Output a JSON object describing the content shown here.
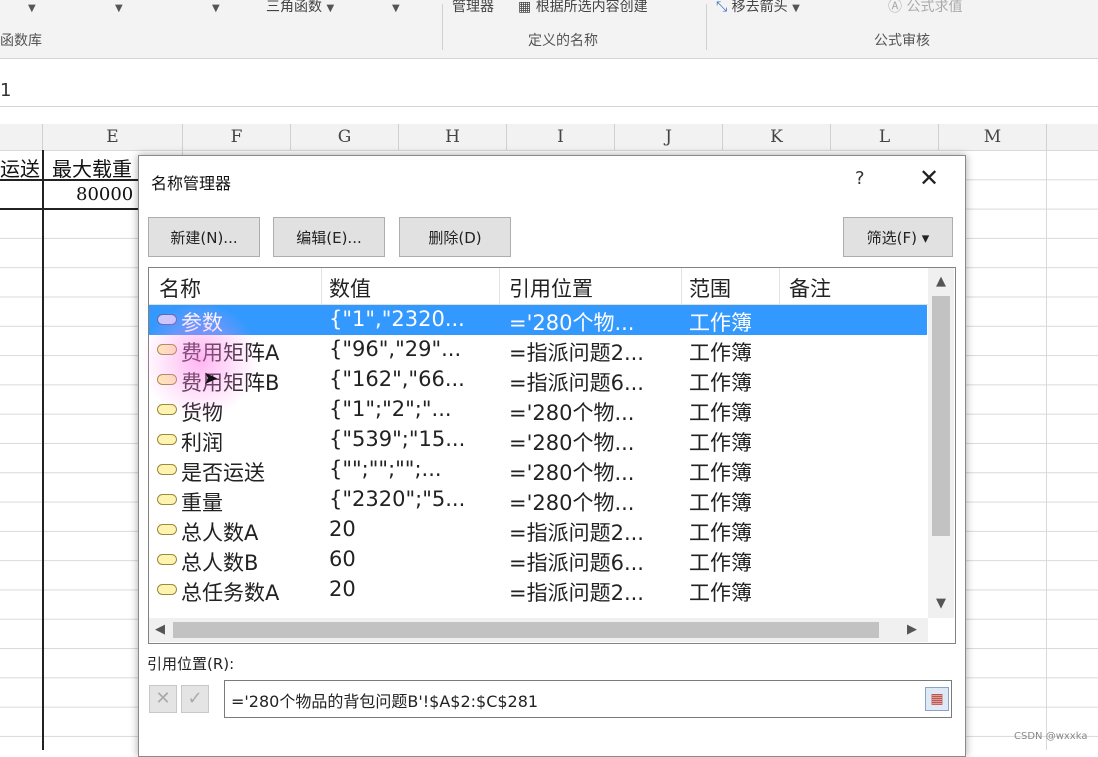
{
  "ribbon": {
    "fn_library_label": "函数库",
    "trig_label": "三角函数",
    "name_manager_label": "管理器",
    "create_from_selection_label": "根据所选内容创建",
    "remove_arrows_label": "移去箭头",
    "show_formulas_label": "公式求值",
    "defined_names_group": "定义的名称",
    "formula_audit_group": "公式审核"
  },
  "formula_bar": {
    "cell_ref": "1"
  },
  "sheet": {
    "columns": [
      "E",
      "F",
      "G",
      "H",
      "I",
      "J",
      "K",
      "L",
      "M"
    ],
    "cells": {
      "d1": "运送",
      "e1": "最大载重",
      "e2": "80000"
    }
  },
  "dialog": {
    "title": "名称管理器",
    "help": "?",
    "close": "✕",
    "buttons": {
      "new": "新建(N)...",
      "edit": "编辑(E)...",
      "delete": "删除(D)",
      "filter": "筛选(F) ▾"
    },
    "headers": {
      "name": "名称",
      "value": "数值",
      "refers_to": "引用位置",
      "scope": "范围",
      "comment": "备注"
    },
    "rows": [
      {
        "name": "参数",
        "value": "{\"1\",\"2320...",
        "refers_to": "='280个物...",
        "scope": "工作簿",
        "selected": true
      },
      {
        "name": "费用矩阵A",
        "value": "{\"96\",\"29\"...",
        "refers_to": "=指派问题2...",
        "scope": "工作簿"
      },
      {
        "name": "费用矩阵B",
        "value": "{\"162\",\"66...",
        "refers_to": "=指派问题6...",
        "scope": "工作簿"
      },
      {
        "name": "货物",
        "value": "{\"1\";\"2\";\"...",
        "refers_to": "='280个物...",
        "scope": "工作簿"
      },
      {
        "name": "利润",
        "value": "{\"539\";\"15...",
        "refers_to": "='280个物...",
        "scope": "工作簿"
      },
      {
        "name": "是否运送",
        "value": "{\"\";\"\";\"\";...",
        "refers_to": "='280个物...",
        "scope": "工作簿"
      },
      {
        "name": "重量",
        "value": "{\"2320\";\"5...",
        "refers_to": "='280个物...",
        "scope": "工作簿"
      },
      {
        "name": "总人数A",
        "value": "20",
        "refers_to": "=指派问题2...",
        "scope": "工作簿"
      },
      {
        "name": "总人数B",
        "value": "60",
        "refers_to": "=指派问题6...",
        "scope": "工作簿"
      },
      {
        "name": "总任务数A",
        "value": "20",
        "refers_to": "=指派问题2...",
        "scope": "工作簿"
      }
    ],
    "ref_label": "引用位置(R):",
    "ref_value": "='280个物品的背包问题B'!$A$2:$C$281"
  },
  "watermark": "CSDN @wxxka"
}
